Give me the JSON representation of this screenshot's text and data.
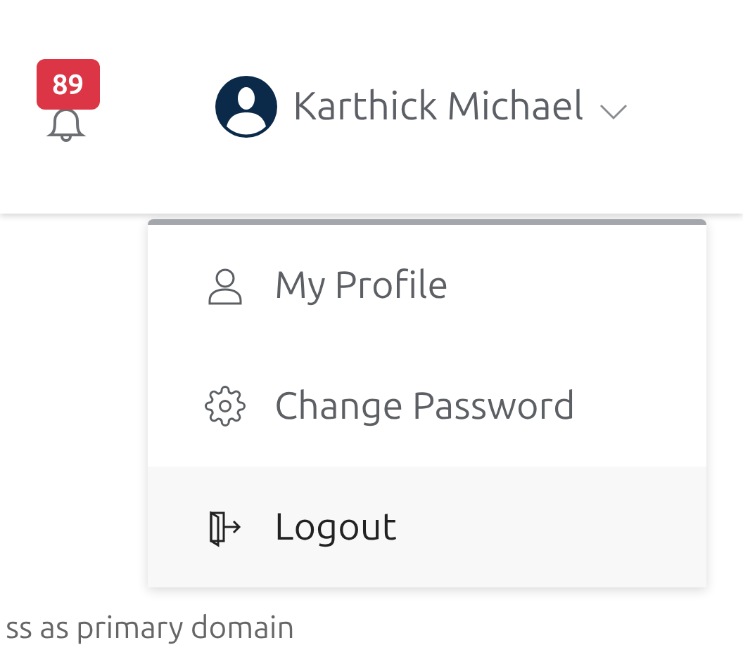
{
  "header": {
    "notification_count": "89",
    "user": {
      "name": "Karthick Michael"
    }
  },
  "menu": {
    "items": [
      {
        "kind": "profile",
        "label": "My Profile",
        "selected": false
      },
      {
        "kind": "password",
        "label": "Change Password",
        "selected": false
      },
      {
        "kind": "logout",
        "label": "Logout",
        "selected": true
      }
    ]
  },
  "page_text": "ss as primary domain"
}
